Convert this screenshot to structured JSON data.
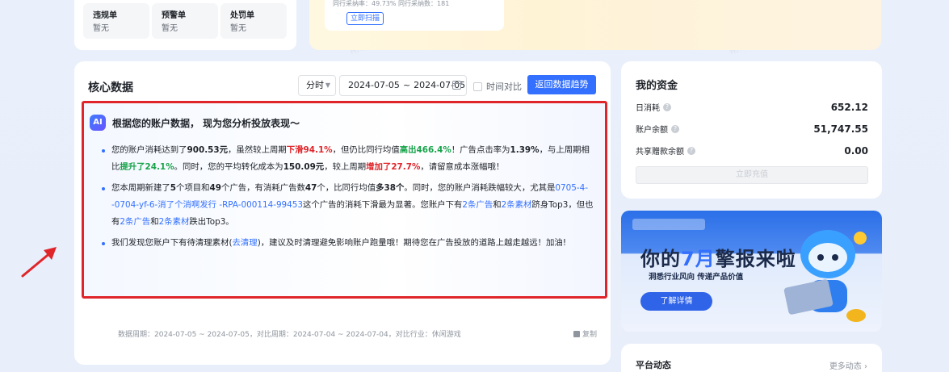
{
  "top_left": {
    "cards": [
      {
        "title": "违规单",
        "value": "暂无"
      },
      {
        "title": "预警单",
        "value": "暂无"
      },
      {
        "title": "处罚单",
        "value": "暂无"
      }
    ]
  },
  "top_mid": {
    "stat_text": "同行采纳率：49.73%   同行采纳数：181",
    "scan_label": "立即扫描"
  },
  "core": {
    "title": "核心数据",
    "granularity": "分时",
    "date_start": "2024-07-05",
    "date_sep": "~",
    "date_end": "2024-07-05",
    "compare_label": "时间对比",
    "trend_button": "返回数据趋势",
    "ai": {
      "badge": "AI",
      "title": "根据您的账户数据， 现为您分析投放表现～",
      "p1": {
        "t1": "您的账户消耗达到了",
        "v1": "900.53元",
        "t2": "，虽然较上周期",
        "v2": "下滑94.1%",
        "t3": "，但仍比同行均值",
        "v3": "高出466.4%",
        "t4": "！广告点击率为",
        "v4": "1.39%",
        "t5": "，与上周期相比",
        "v5": "提升了24.1%",
        "t6": "。同时，您的平均转化成本为",
        "v6": "150.09元",
        "t7": "，较上周期",
        "v7": "增加了27.7%",
        "t8": "，请留意成本涨幅哦！"
      },
      "p2": {
        "t1": "您本周期新建了",
        "v1": "5",
        "t2": "个项目和",
        "v2": "49",
        "t3": "个广告，有消耗广告数",
        "v3": "47",
        "t4": "个，比同行均值",
        "v4": "多38个",
        "t5": "。同时，您的账户消耗跌幅较大，尤其是",
        "l1": "0705-4--0704-yf-6-消了个消啊发行 -RPA-000114-99453",
        "t6": "这个广告的消耗下滑最为显著。您账户下有",
        "l2": "2条广告",
        "t7": "和",
        "l3": "2条素材",
        "t8": "跻身Top3，但也有",
        "l4": "2条广告",
        "t9": "和",
        "l5": "2条素材",
        "t10": "跌出Top3。"
      },
      "p3": {
        "t1": "我们发现您账户下有待清理素材(",
        "l1": "去清理",
        "t2": ")，建议及时清理避免影响账户跑量哦！期待您在广告投放的道路上越走越远！加油!"
      }
    },
    "footer_note": "数据周期：2024-07-05 ~ 2024-07-05，对比周期：2024-07-04 ~ 2024-07-04，对比行业：休闲游戏",
    "copy_label": "复制"
  },
  "funds": {
    "title": "我的资金",
    "rows": [
      {
        "label": "日消耗",
        "value": "652.12"
      },
      {
        "label": "账户余额",
        "value": "51,747.55"
      },
      {
        "label": "共享赠款余额",
        "value": "0.00"
      }
    ],
    "recharge_label": "立即充值"
  },
  "banner": {
    "headline_a": "你的",
    "headline_b": "7月",
    "headline_c": "擎报来啦",
    "sub": "洞悉行业风向   传递产品价值",
    "button": "了解详情"
  },
  "news": {
    "title": "平台动态",
    "more": "更多动态 ›"
  },
  "colors": {
    "accent": "#3370ff",
    "highlight_border": "#e0252a",
    "positive": "#17a34a",
    "negative": "#e0252a"
  }
}
